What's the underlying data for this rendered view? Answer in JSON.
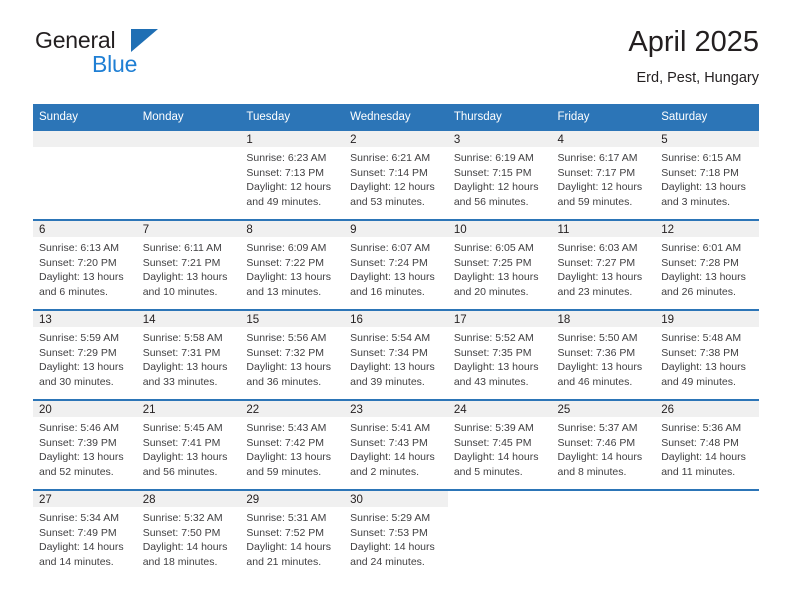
{
  "brand": {
    "name_part1": "General",
    "name_part2": "Blue",
    "triangle_color": "#1f6fb4",
    "blue_text_color": "#1f7fd4"
  },
  "header": {
    "title": "April 2025",
    "location": "Erd, Pest, Hungary"
  },
  "theme": {
    "header_bg": "#2c75b7",
    "daynum_strip_bg": "#f0f0f0",
    "text_color": "#231f20",
    "detail_text_color": "#414042"
  },
  "weekday_headers": [
    "Sunday",
    "Monday",
    "Tuesday",
    "Wednesday",
    "Thursday",
    "Friday",
    "Saturday"
  ],
  "weeks": [
    {
      "days": [
        {
          "day": "",
          "sunrise": "",
          "sunset": "",
          "daylight1": "",
          "daylight2": ""
        },
        {
          "day": "",
          "sunrise": "",
          "sunset": "",
          "daylight1": "",
          "daylight2": ""
        },
        {
          "day": "1",
          "sunrise": "Sunrise: 6:23 AM",
          "sunset": "Sunset: 7:13 PM",
          "daylight1": "Daylight: 12 hours",
          "daylight2": "and 49 minutes."
        },
        {
          "day": "2",
          "sunrise": "Sunrise: 6:21 AM",
          "sunset": "Sunset: 7:14 PM",
          "daylight1": "Daylight: 12 hours",
          "daylight2": "and 53 minutes."
        },
        {
          "day": "3",
          "sunrise": "Sunrise: 6:19 AM",
          "sunset": "Sunset: 7:15 PM",
          "daylight1": "Daylight: 12 hours",
          "daylight2": "and 56 minutes."
        },
        {
          "day": "4",
          "sunrise": "Sunrise: 6:17 AM",
          "sunset": "Sunset: 7:17 PM",
          "daylight1": "Daylight: 12 hours",
          "daylight2": "and 59 minutes."
        },
        {
          "day": "5",
          "sunrise": "Sunrise: 6:15 AM",
          "sunset": "Sunset: 7:18 PM",
          "daylight1": "Daylight: 13 hours",
          "daylight2": "and 3 minutes."
        }
      ]
    },
    {
      "days": [
        {
          "day": "6",
          "sunrise": "Sunrise: 6:13 AM",
          "sunset": "Sunset: 7:20 PM",
          "daylight1": "Daylight: 13 hours",
          "daylight2": "and 6 minutes."
        },
        {
          "day": "7",
          "sunrise": "Sunrise: 6:11 AM",
          "sunset": "Sunset: 7:21 PM",
          "daylight1": "Daylight: 13 hours",
          "daylight2": "and 10 minutes."
        },
        {
          "day": "8",
          "sunrise": "Sunrise: 6:09 AM",
          "sunset": "Sunset: 7:22 PM",
          "daylight1": "Daylight: 13 hours",
          "daylight2": "and 13 minutes."
        },
        {
          "day": "9",
          "sunrise": "Sunrise: 6:07 AM",
          "sunset": "Sunset: 7:24 PM",
          "daylight1": "Daylight: 13 hours",
          "daylight2": "and 16 minutes."
        },
        {
          "day": "10",
          "sunrise": "Sunrise: 6:05 AM",
          "sunset": "Sunset: 7:25 PM",
          "daylight1": "Daylight: 13 hours",
          "daylight2": "and 20 minutes."
        },
        {
          "day": "11",
          "sunrise": "Sunrise: 6:03 AM",
          "sunset": "Sunset: 7:27 PM",
          "daylight1": "Daylight: 13 hours",
          "daylight2": "and 23 minutes."
        },
        {
          "day": "12",
          "sunrise": "Sunrise: 6:01 AM",
          "sunset": "Sunset: 7:28 PM",
          "daylight1": "Daylight: 13 hours",
          "daylight2": "and 26 minutes."
        }
      ]
    },
    {
      "days": [
        {
          "day": "13",
          "sunrise": "Sunrise: 5:59 AM",
          "sunset": "Sunset: 7:29 PM",
          "daylight1": "Daylight: 13 hours",
          "daylight2": "and 30 minutes."
        },
        {
          "day": "14",
          "sunrise": "Sunrise: 5:58 AM",
          "sunset": "Sunset: 7:31 PM",
          "daylight1": "Daylight: 13 hours",
          "daylight2": "and 33 minutes."
        },
        {
          "day": "15",
          "sunrise": "Sunrise: 5:56 AM",
          "sunset": "Sunset: 7:32 PM",
          "daylight1": "Daylight: 13 hours",
          "daylight2": "and 36 minutes."
        },
        {
          "day": "16",
          "sunrise": "Sunrise: 5:54 AM",
          "sunset": "Sunset: 7:34 PM",
          "daylight1": "Daylight: 13 hours",
          "daylight2": "and 39 minutes."
        },
        {
          "day": "17",
          "sunrise": "Sunrise: 5:52 AM",
          "sunset": "Sunset: 7:35 PM",
          "daylight1": "Daylight: 13 hours",
          "daylight2": "and 43 minutes."
        },
        {
          "day": "18",
          "sunrise": "Sunrise: 5:50 AM",
          "sunset": "Sunset: 7:36 PM",
          "daylight1": "Daylight: 13 hours",
          "daylight2": "and 46 minutes."
        },
        {
          "day": "19",
          "sunrise": "Sunrise: 5:48 AM",
          "sunset": "Sunset: 7:38 PM",
          "daylight1": "Daylight: 13 hours",
          "daylight2": "and 49 minutes."
        }
      ]
    },
    {
      "days": [
        {
          "day": "20",
          "sunrise": "Sunrise: 5:46 AM",
          "sunset": "Sunset: 7:39 PM",
          "daylight1": "Daylight: 13 hours",
          "daylight2": "and 52 minutes."
        },
        {
          "day": "21",
          "sunrise": "Sunrise: 5:45 AM",
          "sunset": "Sunset: 7:41 PM",
          "daylight1": "Daylight: 13 hours",
          "daylight2": "and 56 minutes."
        },
        {
          "day": "22",
          "sunrise": "Sunrise: 5:43 AM",
          "sunset": "Sunset: 7:42 PM",
          "daylight1": "Daylight: 13 hours",
          "daylight2": "and 59 minutes."
        },
        {
          "day": "23",
          "sunrise": "Sunrise: 5:41 AM",
          "sunset": "Sunset: 7:43 PM",
          "daylight1": "Daylight: 14 hours",
          "daylight2": "and 2 minutes."
        },
        {
          "day": "24",
          "sunrise": "Sunrise: 5:39 AM",
          "sunset": "Sunset: 7:45 PM",
          "daylight1": "Daylight: 14 hours",
          "daylight2": "and 5 minutes."
        },
        {
          "day": "25",
          "sunrise": "Sunrise: 5:37 AM",
          "sunset": "Sunset: 7:46 PM",
          "daylight1": "Daylight: 14 hours",
          "daylight2": "and 8 minutes."
        },
        {
          "day": "26",
          "sunrise": "Sunrise: 5:36 AM",
          "sunset": "Sunset: 7:48 PM",
          "daylight1": "Daylight: 14 hours",
          "daylight2": "and 11 minutes."
        }
      ]
    },
    {
      "days": [
        {
          "day": "27",
          "sunrise": "Sunrise: 5:34 AM",
          "sunset": "Sunset: 7:49 PM",
          "daylight1": "Daylight: 14 hours",
          "daylight2": "and 14 minutes."
        },
        {
          "day": "28",
          "sunrise": "Sunrise: 5:32 AM",
          "sunset": "Sunset: 7:50 PM",
          "daylight1": "Daylight: 14 hours",
          "daylight2": "and 18 minutes."
        },
        {
          "day": "29",
          "sunrise": "Sunrise: 5:31 AM",
          "sunset": "Sunset: 7:52 PM",
          "daylight1": "Daylight: 14 hours",
          "daylight2": "and 21 minutes."
        },
        {
          "day": "30",
          "sunrise": "Sunrise: 5:29 AM",
          "sunset": "Sunset: 7:53 PM",
          "daylight1": "Daylight: 14 hours",
          "daylight2": "and 24 minutes."
        },
        {
          "day": "",
          "sunrise": "",
          "sunset": "",
          "daylight1": "",
          "daylight2": ""
        },
        {
          "day": "",
          "sunrise": "",
          "sunset": "",
          "daylight1": "",
          "daylight2": ""
        },
        {
          "day": "",
          "sunrise": "",
          "sunset": "",
          "daylight1": "",
          "daylight2": ""
        }
      ]
    }
  ]
}
